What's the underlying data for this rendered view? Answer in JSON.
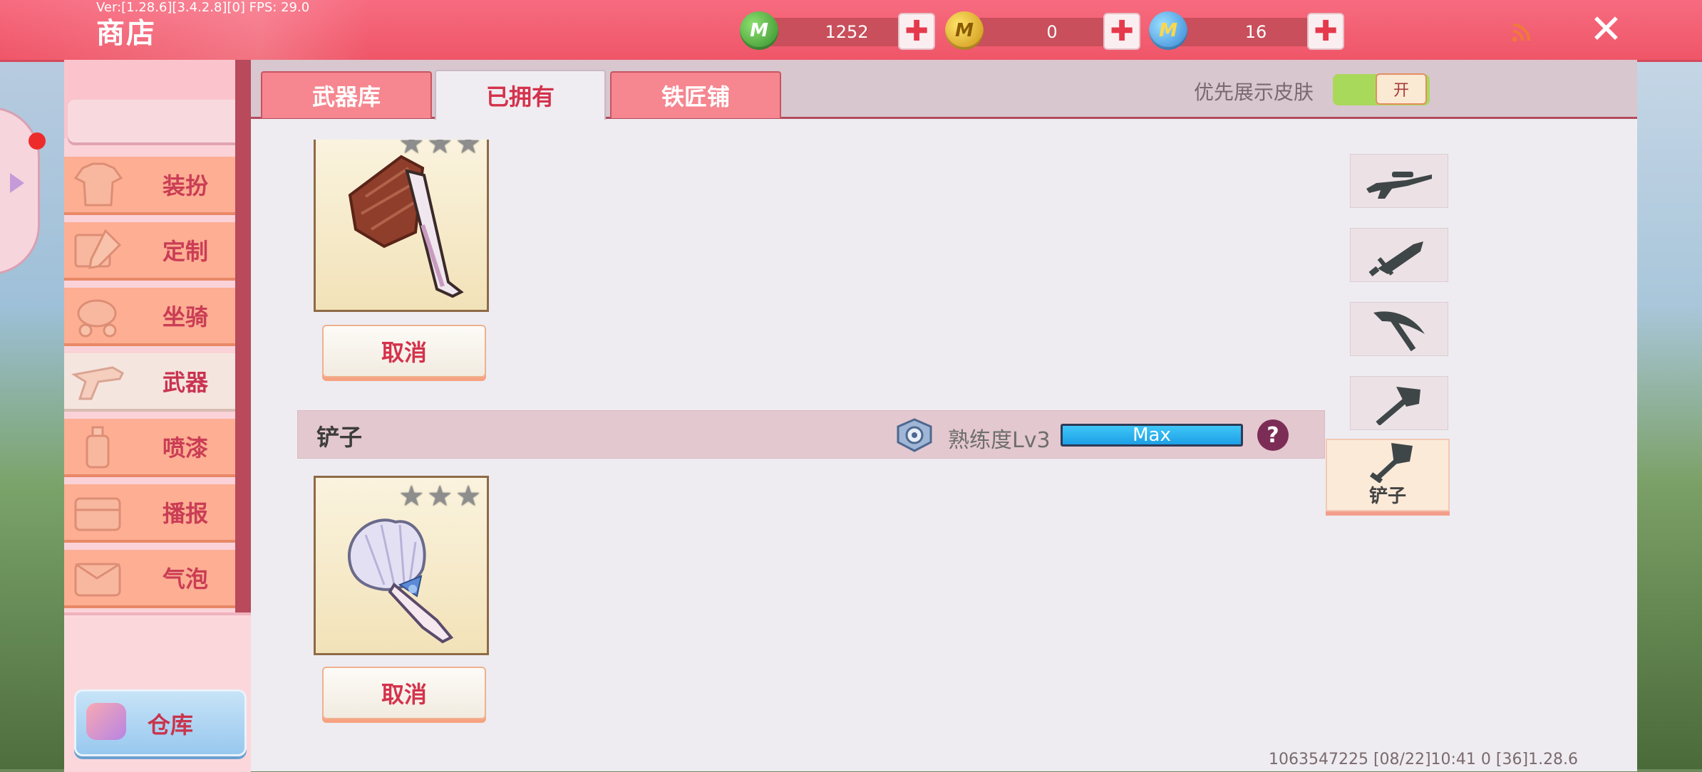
{
  "version_text": "Ver:[1.28.6][3.4.2.8][0] FPS: 29.0",
  "header": {
    "title": "商店",
    "currencies": [
      {
        "name": "green-gem",
        "letter": "M",
        "value": "1252",
        "color": "#46a83a"
      },
      {
        "name": "gold-coin",
        "letter": "M",
        "value": "0",
        "color": "#e8b81d"
      },
      {
        "name": "blue-gem",
        "letter": "M",
        "value": "16",
        "color": "#3aa0e6"
      }
    ],
    "close_symbol": "✕"
  },
  "sidebar": {
    "items": [
      {
        "label": "装扮"
      },
      {
        "label": "定制"
      },
      {
        "label": "坐骑"
      },
      {
        "label": "武器",
        "active": true
      },
      {
        "label": "喷漆"
      },
      {
        "label": "播报"
      },
      {
        "label": "气泡"
      }
    ],
    "warehouse_label": "仓库"
  },
  "tabs": [
    {
      "label": "武器库"
    },
    {
      "label": "已拥有",
      "active": true
    },
    {
      "label": "铁匠铺"
    }
  ],
  "skin_toggle": {
    "label": "优先展示皮肤",
    "state": "开"
  },
  "items": [
    {
      "stars": 3,
      "cancel_label": "取消",
      "icon": "axe-skin"
    },
    {
      "stars": 3,
      "cancel_label": "取消",
      "icon": "shell-shovel-skin"
    }
  ],
  "shovel_row": {
    "name": "铲子",
    "mastery": "熟练度Lv3",
    "progress_label": "Max",
    "help": "?"
  },
  "categories": [
    {
      "icon": "rifle-icon"
    },
    {
      "icon": "sword-icon"
    },
    {
      "icon": "pickaxe-icon"
    },
    {
      "icon": "axe-icon"
    },
    {
      "icon": "shovel-icon",
      "label": "铲子",
      "active": true
    }
  ],
  "footer_info": "1063547225  [08/22]10:41 0  [36]1.28.6"
}
